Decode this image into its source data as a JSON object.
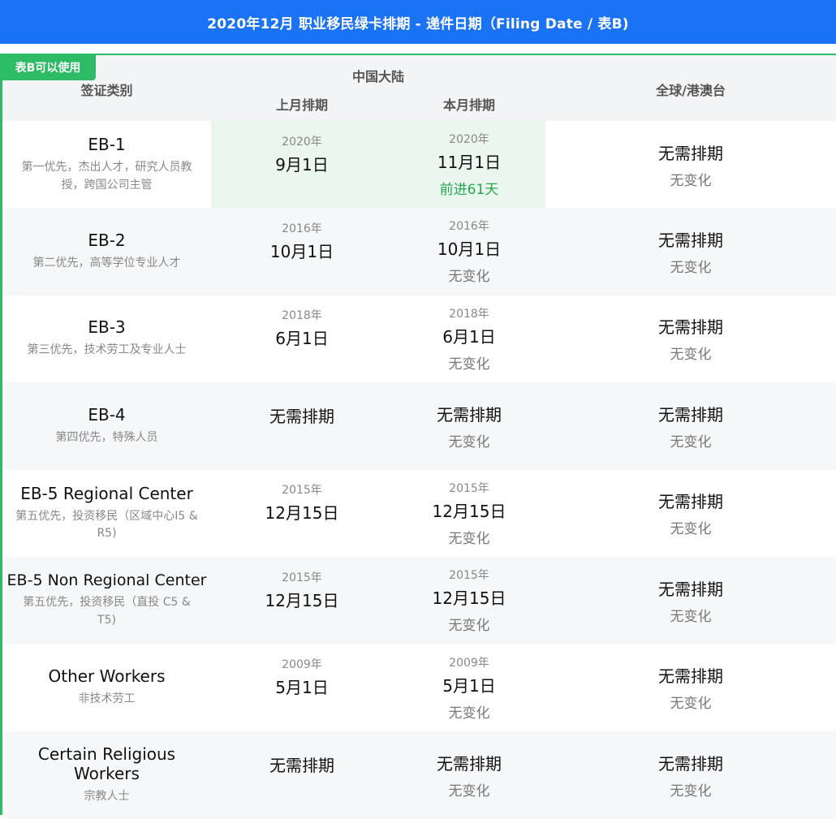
{
  "banner": {
    "title": "2020年12月 职业移民绿卡排期 - 递件日期（Filing Date / 表B)"
  },
  "badge": "表B可以使用",
  "header": {
    "visa_category": "签证类别",
    "mainland": "中国大陆",
    "prev_month": "上月排期",
    "curr_month": "本月排期",
    "global": "全球/港澳台"
  },
  "rows": [
    {
      "name": "EB-1",
      "desc": "第一优先，杰出人才，研究人员教授，跨国公司主管",
      "prev_year": "2020年",
      "prev_date": "9月1日",
      "curr_year": "2020年",
      "curr_date": "11月1日",
      "curr_change": "前进61天",
      "global_main": "无需排期",
      "global_change": "无变化"
    },
    {
      "name": "EB-2",
      "desc": "第二优先，高等学位专业人才",
      "prev_year": "2016年",
      "prev_date": "10月1日",
      "curr_year": "2016年",
      "curr_date": "10月1日",
      "curr_change": "无变化",
      "global_main": "无需排期",
      "global_change": "无变化"
    },
    {
      "name": "EB-3",
      "desc": "第三优先，技术劳工及专业人士",
      "prev_year": "2018年",
      "prev_date": "6月1日",
      "curr_year": "2018年",
      "curr_date": "6月1日",
      "curr_change": "无变化",
      "global_main": "无需排期",
      "global_change": "无变化"
    },
    {
      "name": "EB-4",
      "desc": "第四优先，特殊人员",
      "prev_date": "无需排期",
      "curr_date": "无需排期",
      "curr_change": "无变化",
      "global_main": "无需排期",
      "global_change": "无变化"
    },
    {
      "name": "EB-5 Regional Center",
      "desc": "第五优先，投资移民（区域中心I5 & R5)",
      "prev_year": "2015年",
      "prev_date": "12月15日",
      "curr_year": "2015年",
      "curr_date": "12月15日",
      "curr_change": "无变化",
      "global_main": "无需排期",
      "global_change": "无变化"
    },
    {
      "name": "EB-5 Non Regional Center",
      "desc": "第五优先，投资移民（直投 C5 & T5)",
      "prev_year": "2015年",
      "prev_date": "12月15日",
      "curr_year": "2015年",
      "curr_date": "12月15日",
      "curr_change": "无变化",
      "global_main": "无需排期",
      "global_change": "无变化"
    },
    {
      "name": "Other Workers",
      "desc": "非技术劳工",
      "prev_year": "2009年",
      "prev_date": "5月1日",
      "curr_year": "2009年",
      "curr_date": "5月1日",
      "curr_change": "无变化",
      "global_main": "无需排期",
      "global_change": "无变化"
    },
    {
      "name": "Certain Religious Workers",
      "desc": "宗教人士",
      "prev_date": "无需排期",
      "curr_date": "无需排期",
      "curr_change": "无变化",
      "global_main": "无需排期",
      "global_change": "无变化"
    }
  ]
}
